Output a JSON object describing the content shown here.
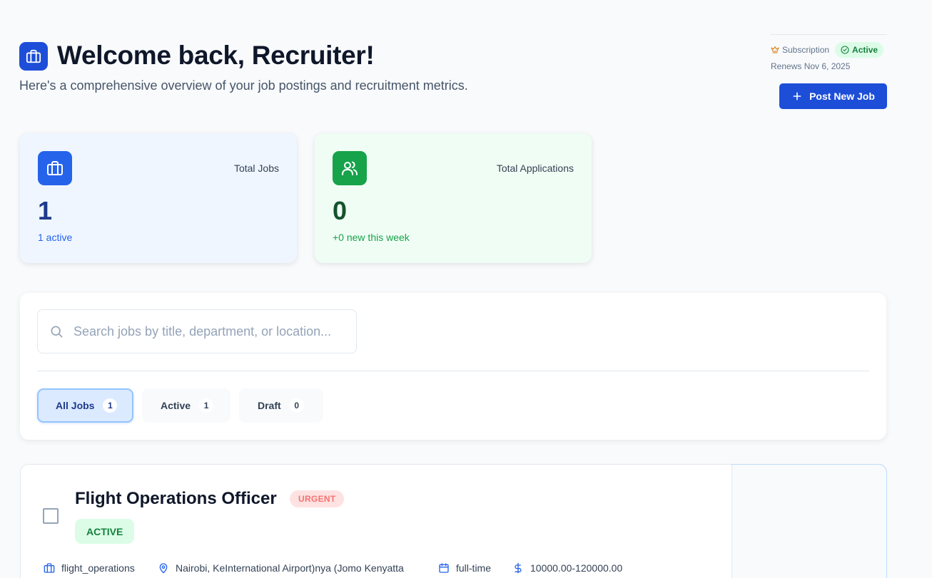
{
  "header": {
    "title": "Welcome back, Recruiter!",
    "subtitle": "Here's a comprehensive overview of your job postings and recruitment metrics.",
    "icon": "briefcase-icon"
  },
  "subscription": {
    "label": "Subscription",
    "status": "Active",
    "renews": "Renews Nov 6, 2025"
  },
  "actions": {
    "post_job": "Post New Job"
  },
  "stats": [
    {
      "label": "Total Jobs",
      "value": "1",
      "note": "1 active",
      "icon": "briefcase-icon",
      "color": "#2563eb"
    },
    {
      "label": "Total Applications",
      "value": "0",
      "note": "+0 new this week",
      "icon": "users-icon",
      "color": "#16a34a"
    }
  ],
  "search": {
    "placeholder": "Search jobs by title, department, or location..."
  },
  "tabs": [
    {
      "label": "All Jobs",
      "count": "1",
      "selected": true
    },
    {
      "label": "Active",
      "count": "1",
      "selected": false
    },
    {
      "label": "Draft",
      "count": "0",
      "selected": false
    }
  ],
  "job": {
    "title": "Flight Operations Officer",
    "priority": "URGENT",
    "status": "ACTIVE",
    "department": "flight_operations",
    "location": "Nairobi, KeInternational Airport)nya (Jomo Kenyatta",
    "type": "full-time",
    "salary": "10000.00-120000.00"
  }
}
